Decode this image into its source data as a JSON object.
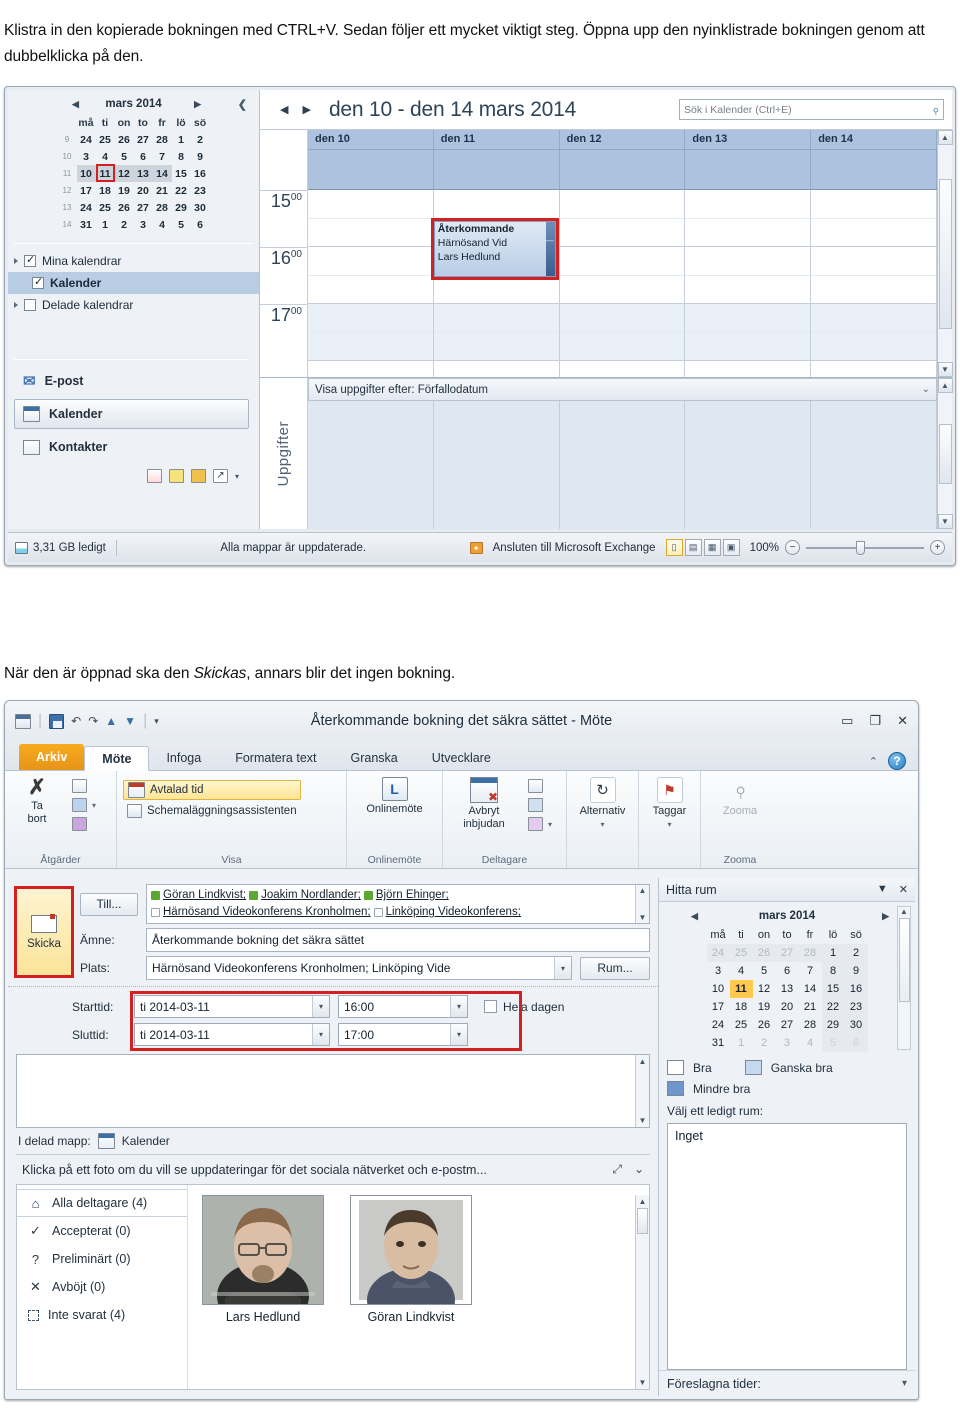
{
  "document": {
    "intro_paragraph": "Klistra in den kopierade bokningen med CTRL+V. Sedan följer ett mycket viktigt steg. Öppna upp den nyinklistrade bokningen genom att dubbelklicka på den.",
    "mid_paragraph_pre": "När den är öppnad ska den ",
    "mid_paragraph_italic": "Skickas",
    "mid_paragraph_post": ", annars blir det ingen bokning."
  },
  "calendar_shot": {
    "date_navigator": {
      "month_label": "mars 2014",
      "prev_arrow": "◀",
      "next_arrow": "▶",
      "collapse_arrow": "❮",
      "weekday_headers": [
        "må",
        "ti",
        "on",
        "to",
        "fr",
        "lö",
        "sö"
      ],
      "week_numbers": [
        "9",
        "10",
        "11",
        "12",
        "13",
        "14"
      ],
      "weeks": [
        [
          "24",
          "25",
          "26",
          "27",
          "28",
          "1",
          "2"
        ],
        [
          "3",
          "4",
          "5",
          "6",
          "7",
          "8",
          "9"
        ],
        [
          "10",
          "11",
          "12",
          "13",
          "14",
          "15",
          "16"
        ],
        [
          "17",
          "18",
          "19",
          "20",
          "21",
          "22",
          "23"
        ],
        [
          "24",
          "25",
          "26",
          "27",
          "28",
          "29",
          "30"
        ],
        [
          "31",
          "1",
          "2",
          "3",
          "4",
          "5",
          "6"
        ]
      ],
      "today": "11",
      "selected_week_index": 2
    },
    "calendar_list": [
      {
        "label": "Mina kalendrar",
        "checked": true,
        "expanded": true,
        "selected": false
      },
      {
        "label": "Kalender",
        "checked": true,
        "indent": true,
        "selected": true
      },
      {
        "label": "Delade kalendrar",
        "checked": false,
        "expanded": false,
        "selected": false
      }
    ],
    "module_buttons": [
      {
        "label": "E-post",
        "icon": "mail-icon",
        "active": false
      },
      {
        "label": "Kalender",
        "icon": "calendar-icon",
        "active": true
      },
      {
        "label": "Kontakter",
        "icon": "contacts-icon",
        "active": false
      }
    ],
    "main": {
      "range_title": "den 10 - den 14 mars 2014",
      "search_placeholder": "Sök i Kalender (Ctrl+E)",
      "prev_arrow": "◀",
      "next_arrow": "▶",
      "day_headers": [
        "den 10",
        "den 11",
        "den 12",
        "den 13",
        "den 14"
      ],
      "hours": [
        "15",
        "16",
        "17"
      ],
      "hour_minutes": "00",
      "appointment": {
        "title": "Återkommande",
        "location": "Härnösand Vid",
        "organizer": "Lars Hedlund",
        "day_index": 1,
        "highlight_color": "#d42020"
      }
    },
    "tasks": {
      "spine_label": "Uppgifter",
      "sort_label": "Visa uppgifter efter: Förfallodatum"
    },
    "status_bar": {
      "free_space": "3,31 GB ledigt",
      "folders_status": "Alla mappar är uppdaterade.",
      "connection": "Ansluten till Microsoft Exchange",
      "zoom": "100%",
      "zoom_out": "−",
      "zoom_in": "+",
      "view_buttons": [
        "reading-view",
        "day-view",
        "grid-view",
        "normal-view"
      ]
    }
  },
  "meeting_shot": {
    "title_bar": {
      "title": "Återkommande bokning det säkra sättet  -  Möte",
      "quick_access": [
        "calendar-icon",
        "save-icon",
        "undo-icon",
        "redo-icon",
        "up-arrow-icon",
        "down-arrow-icon",
        "customize-icon"
      ],
      "minimize": "▭",
      "restore": "❐",
      "close": "✕"
    },
    "tabs": [
      {
        "label": "Arkiv",
        "type": "file"
      },
      {
        "label": "Möte",
        "type": "active"
      },
      {
        "label": "Infoga",
        "type": "normal"
      },
      {
        "label": "Formatera text",
        "type": "normal"
      },
      {
        "label": "Granska",
        "type": "normal"
      },
      {
        "label": "Utvecklare",
        "type": "normal"
      }
    ],
    "ribbon": {
      "help_icon": "help-icon",
      "collapse_icon": "collapse-ribbon-icon",
      "groups": [
        {
          "name": "Åtgärder",
          "big_buttons": [
            {
              "label": "Ta\nbort",
              "line1": "Ta",
              "line2": "bort",
              "icon": "delete-x-icon"
            }
          ],
          "small_items": [
            {
              "label": "",
              "icon": "forward-preview-icon"
            },
            {
              "label": "",
              "icon": "forward-mail-icon",
              "caret": true
            },
            {
              "label": "",
              "icon": "onenote-icon"
            }
          ]
        },
        {
          "name": "Visa",
          "small_items": [
            {
              "label": "Avtalad tid",
              "icon": "appointment-icon",
              "highlighted": true
            },
            {
              "label": "Schemaläggningsassistenten",
              "icon": "scheduling-icon",
              "highlighted": false
            }
          ]
        },
        {
          "name": "Onlinemöte",
          "big_buttons": [
            {
              "line1": "Onlinemöte",
              "line2": "",
              "icon": "lync-icon"
            }
          ]
        },
        {
          "name": "Deltagare",
          "big_buttons": [
            {
              "line1": "Avbryt",
              "line2": "inbjudan",
              "icon": "cancel-invitation-icon"
            }
          ],
          "small_items": [
            {
              "label": "",
              "icon": "address-book-icon"
            },
            {
              "label": "",
              "icon": "check-names-icon"
            },
            {
              "label": "",
              "icon": "response-options-icon",
              "caret": true
            }
          ]
        },
        {
          "name": "",
          "big_buttons": [
            {
              "line1": "Alternativ",
              "line2": "▾",
              "icon": "recurrence-icon"
            }
          ]
        },
        {
          "name": "",
          "big_buttons": [
            {
              "line1": "Taggar",
              "line2": "▾",
              "icon": "flag-icon"
            }
          ]
        },
        {
          "name": "Zooma",
          "big_buttons": [
            {
              "line1": "Zooma",
              "line2": "",
              "icon": "zoom-icon",
              "disabled": true
            }
          ]
        }
      ]
    },
    "form": {
      "send_button": "Skicka",
      "to_button": "Till...",
      "labels": {
        "subject": "Ämne:",
        "location": "Plats:",
        "start": "Starttid:",
        "end": "Sluttid:"
      },
      "recipients_line1": [
        {
          "name": "Göran Lindkvist;",
          "presence": "green"
        },
        {
          "name": "Joakim Nordlander;",
          "presence": "green"
        },
        {
          "name": "Björn Ehinger;",
          "presence": "green"
        }
      ],
      "recipients_line2": [
        {
          "name": "Härnösand Videokonferens Kronholmen;",
          "presence": "none"
        },
        {
          "name": "Linköping Videokonferens;",
          "presence": "none"
        }
      ],
      "subject_value": "Återkommande bokning det säkra sättet",
      "location_value": "Härnösand Videokonferens Kronholmen; Linköping Vide",
      "rooms_button": "Rum...",
      "start_date": "ti 2014-03-11",
      "start_time": "16:00",
      "end_date": "ti 2014-03-11",
      "end_time": "17:00",
      "all_day_label": "Hela dagen",
      "all_day_checked": false,
      "shared_folder_label": "I delad mapp:",
      "shared_folder_value": "Kalender",
      "people_banner": "Klicka på ett foto om du vill se uppdateringar för det sociala nätverket och e-postm...",
      "attendee_filters": [
        {
          "label": "Alla deltagare (4)",
          "icon": "home-icon",
          "selected": true
        },
        {
          "label": "Accepterat (0)",
          "icon": "check-icon",
          "selected": false
        },
        {
          "label": "Preliminärt (0)",
          "icon": "question-icon",
          "selected": false
        },
        {
          "label": "Avböjt (0)",
          "icon": "x-icon",
          "selected": false
        },
        {
          "label": "Inte svarat (4)",
          "icon": "dotted-box-icon",
          "selected": false
        }
      ],
      "attendee_cards": [
        {
          "name": "Lars Hedlund"
        },
        {
          "name": "Göran Lindkvist"
        }
      ]
    },
    "room_finder": {
      "title": "Hitta rum",
      "dropdown_icon": "▼",
      "close_icon": "✕",
      "month_label": "mars 2014",
      "prev_arrow": "◀",
      "next_arrow": "▶",
      "weekday_headers": [
        "må",
        "ti",
        "on",
        "to",
        "fr",
        "lö",
        "sö"
      ],
      "weeks": [
        [
          "24",
          "25",
          "26",
          "27",
          "28",
          "1",
          "2"
        ],
        [
          "3",
          "4",
          "5",
          "6",
          "7",
          "8",
          "9"
        ],
        [
          "10",
          "11",
          "12",
          "13",
          "14",
          "15",
          "16"
        ],
        [
          "17",
          "18",
          "19",
          "20",
          "21",
          "22",
          "23"
        ],
        [
          "24",
          "25",
          "26",
          "27",
          "28",
          "29",
          "30"
        ],
        [
          "31",
          "1",
          "2",
          "3",
          "4",
          "5",
          "6"
        ]
      ],
      "selected_day": "11",
      "legend": [
        {
          "label": "Bra",
          "swatch": "good"
        },
        {
          "label": "Ganska bra",
          "swatch": "ok"
        },
        {
          "label": "Mindre bra",
          "swatch": "bad"
        }
      ],
      "pick_label": "Välj ett ledigt rum:",
      "list_value": "Inget",
      "suggested_label": "Föreslagna tider:"
    }
  }
}
